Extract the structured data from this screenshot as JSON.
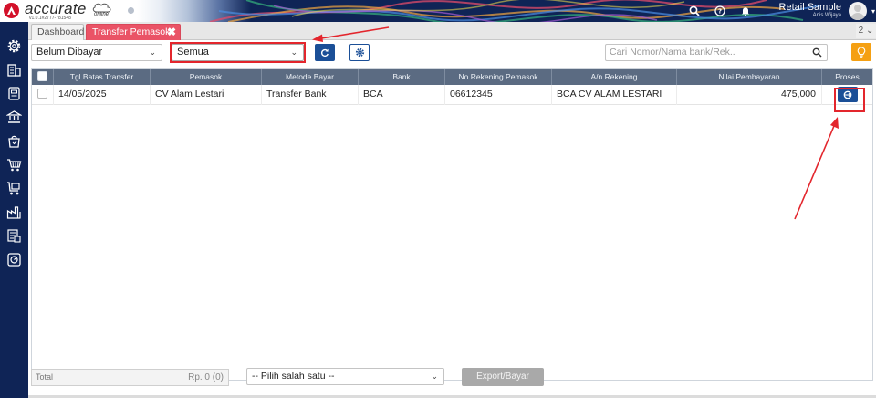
{
  "header": {
    "brand": "accurate",
    "brand_sub": "online",
    "version": "v1.0.1#2777-781548",
    "user_name": "Retail Sample",
    "user_sub": "Anis Wijaya",
    "colors": {
      "navy": "#0f2456",
      "logo_red": "#d3112a"
    },
    "icons": [
      "search-icon",
      "help-icon",
      "bell-icon",
      "avatar",
      "chevron-down-icon"
    ]
  },
  "sidebar": {
    "items": [
      "gear-icon",
      "building-icon",
      "document-icon",
      "bank-icon",
      "bag-icon",
      "cart-icon",
      "truck-cart-icon",
      "factory-icon",
      "report-icon",
      "dashboard-icon"
    ]
  },
  "tabs": {
    "items": [
      {
        "label": "Dashboard",
        "active": false
      },
      {
        "label": "Transfer Pemasok",
        "active": true
      }
    ],
    "count": "2",
    "active_color": "#ea5366"
  },
  "toolbar": {
    "status_value": "Belum Dibayar",
    "filter_value": "Semua",
    "search_placeholder": "Cari Nomor/Nama bank/Rek..",
    "accent": "#1b4f97",
    "highlight": "#e3262d",
    "lightbulb_color": "#f5a013"
  },
  "table": {
    "columns": [
      "Tgl Batas Transfer",
      "Pemasok",
      "Metode Bayar",
      "Bank",
      "No Rekening Pemasok",
      "A/n Rekening",
      "Nilai Pembayaran",
      "Proses"
    ],
    "rows": [
      {
        "date": "14/05/2025",
        "supplier": "CV Alam Lestari",
        "method": "Transfer Bank",
        "bank": "BCA",
        "account_no": "06612345",
        "account_name": "BCA CV ALAM LESTARI",
        "amount": "475,000"
      }
    ]
  },
  "footer": {
    "total_label": "Total",
    "total_value": "Rp. 0 (0)",
    "select_placeholder": "-- Pilih salah satu --",
    "export_label": "Export/Bayar"
  }
}
